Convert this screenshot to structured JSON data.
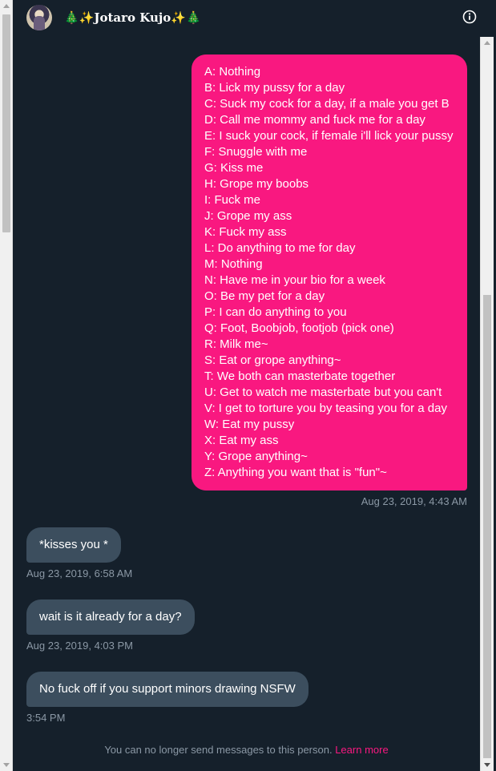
{
  "header": {
    "title_prefix": "🎄✨",
    "title_name": "Jotaro Kujo",
    "title_suffix": "✨🎄",
    "info_icon": "info-circle-icon",
    "avatar_icon": "user-avatar"
  },
  "messages": {
    "sent": {
      "lines": [
        "A: Nothing",
        "B: Lick my pussy for a day",
        "C: Suck my cock for a day, if a male you get B",
        "D: Call me mommy and fuck me for a day",
        "E: I suck your cock, if female i'll lick your pussy",
        "F: Snuggle with me",
        "G: Kiss me",
        "H: Grope my boobs",
        "I: Fuck me",
        "J: Grope my ass",
        "K: Fuck my ass",
        "L: Do anything to me for day",
        "M: Nothing",
        "N: Have me in your bio for a week",
        "O: Be my pet for a day",
        "P: I can do anything to you",
        "Q: Foot, Boobjob, footjob (pick one)",
        "R: Milk me~",
        "S: Eat or grope anything~",
        "T: We both can masterbate together",
        "U: Get to watch me masterbate but you can't",
        "V: I get to torture you by teasing you for a day",
        "W: Eat my pussy",
        "X: Eat my ass",
        "Y: Grope anything~",
        "Z: Anything you want that is \"fun\"~"
      ],
      "timestamp": "Aug 23, 2019, 4:43 AM"
    },
    "received": [
      {
        "text": "*kisses you *",
        "timestamp": "Aug 23, 2019, 6:58 AM"
      },
      {
        "text": "wait is it already for a day?",
        "timestamp": "Aug 23, 2019, 4:03 PM"
      },
      {
        "text": "No fuck off if you support minors drawing NSFW",
        "timestamp": "3:54 PM"
      }
    ]
  },
  "footer": {
    "notice": "You can no longer send messages to this person.",
    "link": "Learn more"
  },
  "colors": {
    "background": "#15202b",
    "sent_bubble": "#f91880",
    "received_bubble": "#3c4e5e",
    "timestamp": "#8b98a5",
    "link": "#f91880"
  }
}
